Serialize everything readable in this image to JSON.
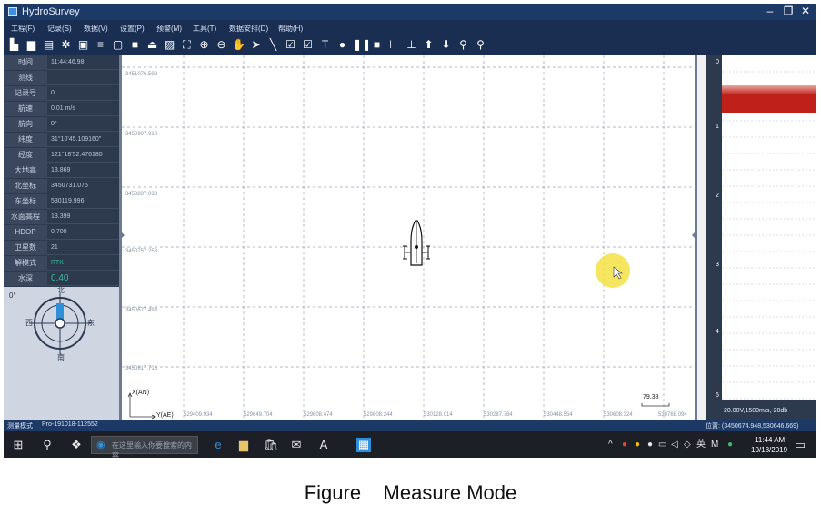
{
  "window": {
    "title": "HydroSurvey",
    "controls": {
      "minimize": "–",
      "restore": "❐",
      "close": "✕"
    }
  },
  "menu": [
    "工程(F)",
    "记录(S)",
    "数据(V)",
    "设置(P)",
    "预警(M)",
    "工具(T)",
    "数据安排(D)",
    "帮助(H)"
  ],
  "info_panel": [
    {
      "label": "时间",
      "value": "11:44:46.98"
    },
    {
      "label": "测线",
      "value": ""
    },
    {
      "label": "记录号",
      "value": "0"
    },
    {
      "label": "航速",
      "value": "0.01 m/s"
    },
    {
      "label": "航向",
      "value": "0°"
    },
    {
      "label": "纬度",
      "value": "31°10'45.109160\""
    },
    {
      "label": "经度",
      "value": "121°18'52.476180"
    },
    {
      "label": "大地高",
      "value": "13.869"
    },
    {
      "label": "北坐标",
      "value": "3450731.075"
    },
    {
      "label": "东坐标",
      "value": "530119.996"
    },
    {
      "label": "水面高程",
      "value": "13.399"
    },
    {
      "label": "HDOP",
      "value": "0.700"
    },
    {
      "label": "卫星数",
      "value": "21"
    },
    {
      "label": "解模式",
      "value": "RTK"
    },
    {
      "label": "水深",
      "value": "0.40"
    }
  ],
  "compass": {
    "heading": "0°",
    "north": "北",
    "east": "东",
    "south": "南",
    "west": "西"
  },
  "map": {
    "north_labels": [
      "3451076.598",
      "3450907.918",
      "3450837.038",
      "3450757.258",
      "3450677.498",
      "3450617.718"
    ],
    "east_labels": [
      "529409.934",
      "529649.704",
      "529808.474",
      "529808.244",
      "530128.014",
      "530287.784",
      "530448.554",
      "530608.324",
      "530768.094"
    ],
    "axis_x": "X(AN)",
    "axis_y": "Y(AE)",
    "scale": "79.38"
  },
  "echogram": {
    "depth_ticks": [
      "0",
      "1",
      "2",
      "3",
      "4",
      "5"
    ],
    "params": "20.00V,1500m/s,-20db"
  },
  "statusbar": {
    "mode": "测量模式",
    "project": "Pro-191018-112552",
    "cursor": "位置: (3450674.948,530646.669)"
  },
  "taskbar": {
    "search_placeholder": "在这里输入你要搜索的内容",
    "time": "11:44 AM",
    "date": "10/18/2019",
    "ime": "英"
  },
  "caption": "Figure    Measure Mode",
  "colors": {
    "titlebar": "#1d3a66",
    "panel": "#2d3a4e",
    "echo_band": "#c0201a",
    "highlight": "#f5e042"
  }
}
